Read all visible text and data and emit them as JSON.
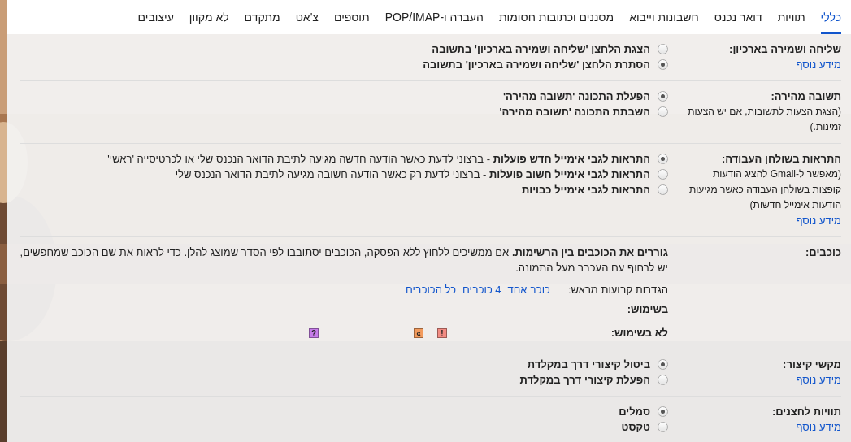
{
  "tabs": [
    {
      "label": "כללי",
      "selected": true
    },
    {
      "label": "תוויות",
      "selected": false
    },
    {
      "label": "דואר נכנס",
      "selected": false
    },
    {
      "label": "חשבונות וייבוא",
      "selected": false
    },
    {
      "label": "מסננים וכתובות חסומות",
      "selected": false
    },
    {
      "label": "העברה ו-POP/IMAP",
      "selected": false
    },
    {
      "label": "תוספים",
      "selected": false
    },
    {
      "label": "צ'אט",
      "selected": false
    },
    {
      "label": "מתקדם",
      "selected": false
    },
    {
      "label": "לא מקוון",
      "selected": false
    },
    {
      "label": "עיצובים",
      "selected": false
    }
  ],
  "settings": [
    {
      "kind": "radios",
      "label": "שליחה ושמירה בארכיון:",
      "link": "מידע נוסף",
      "options": [
        {
          "text": "הצגת הלחצן 'שליחה ושמירה בארכיון' בתשובה",
          "selected": false
        },
        {
          "text": "הסתרת הלחצן 'שליחה ושמירה בארכיון' בתשובה",
          "selected": true
        }
      ]
    },
    {
      "kind": "radios",
      "label": "תשובה מהירה:",
      "description": "(הצגת הצעות לתשובות, אם יש הצעות זמינות.)",
      "options": [
        {
          "text": "הפעלת התכונה 'תשובה מהירה'",
          "selected": true
        },
        {
          "text": "השבתת התכונה 'תשובה מהירה'",
          "selected": false
        }
      ]
    },
    {
      "kind": "radios",
      "label": "התראות בשולחן העבודה:",
      "description": "(מאפשר ל-Gmail להציג הודעות קופצות בשולחן העבודה כאשר מגיעות הודעות אימייל חדשות)",
      "link": "מידע נוסף",
      "options": [
        {
          "text": "**התראות לגבי אימייל חדש פועלות** - ברצוני לדעת כאשר הודעה חדשה מגיעה לתיבת הדואר הנכנס שלי או לכרטיסייה 'ראשי'",
          "selected": true
        },
        {
          "text": "**התראות לגבי אימייל חשוב פועלות** - ברצוני לדעת רק כאשר הודעה חשובה מגיעה לתיבת הדואר הנכנס שלי",
          "selected": false
        },
        {
          "text": "**התראות לגבי אימייל כבויות**",
          "selected": false
        }
      ]
    },
    {
      "kind": "stars",
      "label": "כוכבים:",
      "instructions": "**גוררים את הכוכבים בין הרשימות.**  אם ממשיכים ללחוץ ללא הפסקה, הכוכבים יסתובבו לפי הסדר שמוצג להלן. כדי לראות את שם הכוכב שמחפשים, יש לרחוף עם העכבר מעל התמונה.",
      "presets_label": "הגדרות קבועות מראש:",
      "presets": [
        "כוכב אחד",
        "4 כוכבים",
        "כל הכוכבים"
      ],
      "in_use_label": "בשימוש:",
      "not_in_use_label": "לא בשימוש:",
      "not_in_use": [
        {
          "symbol": "!",
          "color": "#f28b82"
        },
        {
          "symbol": "»",
          "color": "#f29a5c"
        },
        {
          "symbol": "?",
          "color": "#c67be8"
        }
      ]
    },
    {
      "kind": "radios",
      "label": "מקשי קיצור:",
      "link": "מידע נוסף",
      "options": [
        {
          "text": "ביטול קיצורי דרך במקלדת",
          "selected": true
        },
        {
          "text": "הפעלת קיצורי דרך במקלדת",
          "selected": false
        }
      ]
    },
    {
      "kind": "radios",
      "label": "תוויות לחצנים:",
      "link": "מידע נוסף",
      "options": [
        {
          "text": "סמלים",
          "selected": true
        },
        {
          "text": "טקסט",
          "selected": false
        }
      ]
    }
  ]
}
